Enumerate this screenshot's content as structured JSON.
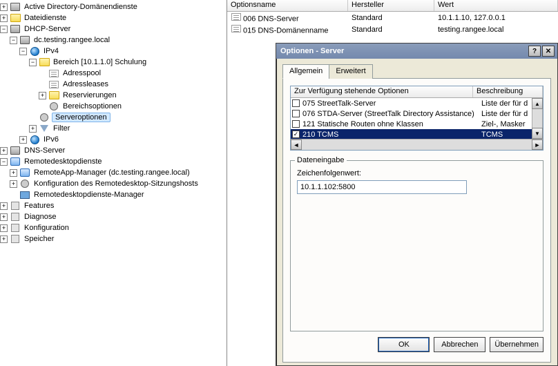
{
  "tree": {
    "ad": "Active Directory-Domänendienste",
    "dateidienste": "Dateidienste",
    "dhcp": "DHCP-Server",
    "dhcp_host": "dc.testing.rangee.local",
    "ipv4": "IPv4",
    "scope": "Bereich [10.1.1.0] Schulung",
    "adresspool": "Adresspool",
    "adressleases": "Adressleases",
    "reservierungen": "Reservierungen",
    "bereichsoptionen": "Bereichsoptionen",
    "serveroptionen": "Serveroptionen",
    "filter": "Filter",
    "ipv6": "IPv6",
    "dns": "DNS-Server",
    "remotedesktop": "Remotedesktopdienste",
    "remoteapp": "RemoteApp-Manager (dc.testing.rangee.local)",
    "rdp_session": "Konfiguration des Remotedesktop-Sitzungshosts",
    "rdp_manager": "Remotedesktopdienste-Manager",
    "features": "Features",
    "diagnose": "Diagnose",
    "konfiguration": "Konfiguration",
    "speicher": "Speicher"
  },
  "list": {
    "cols": {
      "name": "Optionsname",
      "vendor": "Hersteller",
      "value": "Wert"
    },
    "rows": [
      {
        "name": "006 DNS-Server",
        "vendor": "Standard",
        "value": "10.1.1.10, 127.0.0.1"
      },
      {
        "name": "015 DNS-Domänenname",
        "vendor": "Standard",
        "value": "testing.rangee.local"
      }
    ]
  },
  "dialog": {
    "title": "Optionen - Server",
    "tab_general": "Allgemein",
    "tab_extended": "Erweitert",
    "col_option": "Zur Verfügung stehende Optionen",
    "col_desc": "Beschreibung",
    "options": [
      {
        "checked": false,
        "label": "075 StreetTalk-Server",
        "desc": "Liste der für d"
      },
      {
        "checked": false,
        "label": "076 STDA-Server (StreetTalk Directory Assistance)",
        "desc": "Liste der für d"
      },
      {
        "checked": false,
        "label": "121 Statische Routen ohne Klassen",
        "desc": "Ziel-, Masker"
      },
      {
        "checked": true,
        "label": "210 TCMS",
        "desc": "TCMS",
        "selected": true
      }
    ],
    "groupbox": "Dateneingabe",
    "field_label": "Zeichenfolgenwert:",
    "field_value": "10.1.1.102:5800",
    "btn_ok": "OK",
    "btn_cancel": "Abbrechen",
    "btn_apply": "Übernehmen"
  }
}
